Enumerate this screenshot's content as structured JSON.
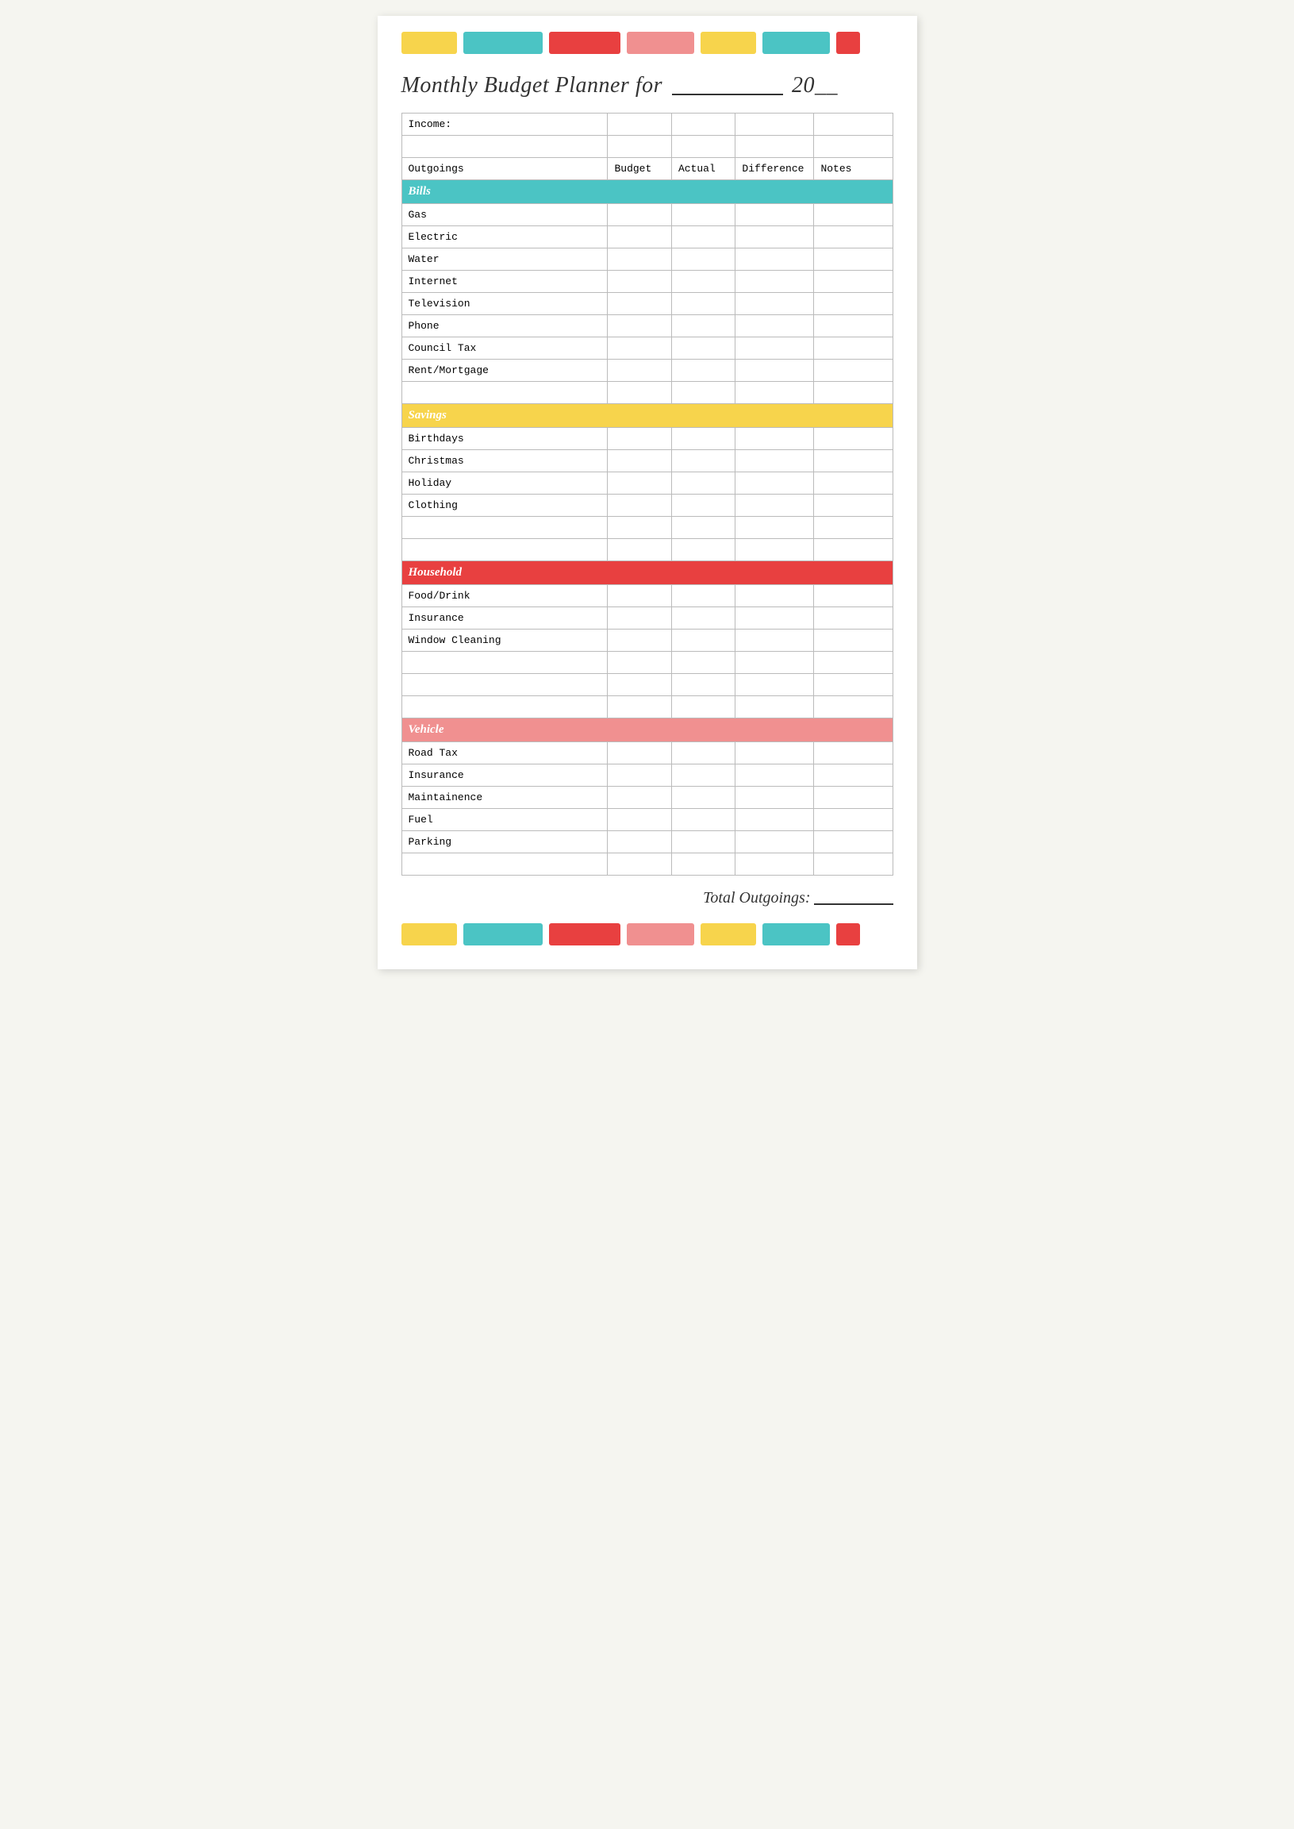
{
  "title": {
    "prefix": "Monthly Budget Planner for",
    "year_prefix": "20",
    "year_suffix": "__"
  },
  "columns": {
    "outgoings": "Outgoings",
    "budget": "Budget",
    "actual": "Actual",
    "difference": "Difference",
    "notes": "Notes"
  },
  "income_label": "Income:",
  "sections": [
    {
      "name": "Bills",
      "color": "bills",
      "items": [
        "Gas",
        "Electric",
        "Water",
        "Internet",
        "Television",
        "Phone",
        "Council Tax",
        "Rent/Mortgage",
        ""
      ]
    },
    {
      "name": "Savings",
      "color": "savings",
      "items": [
        "Birthdays",
        "Christmas",
        "Holiday",
        "Clothing",
        "",
        ""
      ]
    },
    {
      "name": "Household",
      "color": "household",
      "items": [
        "Food/Drink",
        "Insurance",
        "Window Cleaning",
        "",
        "",
        ""
      ]
    },
    {
      "name": "Vehicle",
      "color": "vehicle",
      "items": [
        "Road Tax",
        "Insurance",
        "Maintainence",
        "Fuel",
        "Parking",
        ""
      ]
    }
  ],
  "total_label": "Total Outgoings:",
  "color_bars": [
    {
      "color": "#f7d44c",
      "width": 70
    },
    {
      "color": "#4bc4c4",
      "width": 100
    },
    {
      "color": "#e84040",
      "width": 90
    },
    {
      "color": "#f09090",
      "width": 85
    },
    {
      "color": "#f7d44c",
      "width": 70
    },
    {
      "color": "#4bc4c4",
      "width": 85
    },
    {
      "color": "#e84040",
      "width": 30
    }
  ]
}
